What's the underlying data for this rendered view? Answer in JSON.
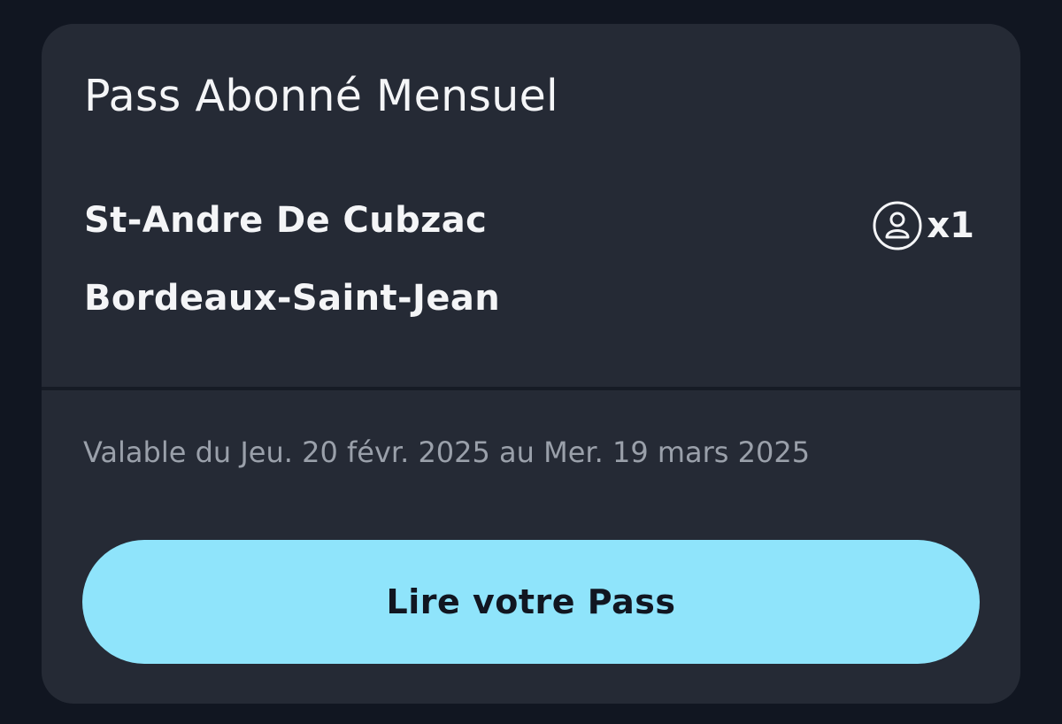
{
  "pass": {
    "title": "Pass Abonné Mensuel",
    "origin": "St-Andre De Cubzac",
    "destination": "Bordeaux-Saint-Jean",
    "passenger_icon": "person-circle-icon",
    "passenger_count": "x1",
    "validity": "Valable du Jeu. 20 févr. 2025 au Mer. 19 mars 2025",
    "read_button_label": "Lire votre Pass"
  },
  "colors": {
    "background": "#111621",
    "card": "#252a35",
    "text": "#f4f5f7",
    "muted_text": "#9aa0aa",
    "button": "#8fe4fb",
    "button_text": "#111621"
  }
}
